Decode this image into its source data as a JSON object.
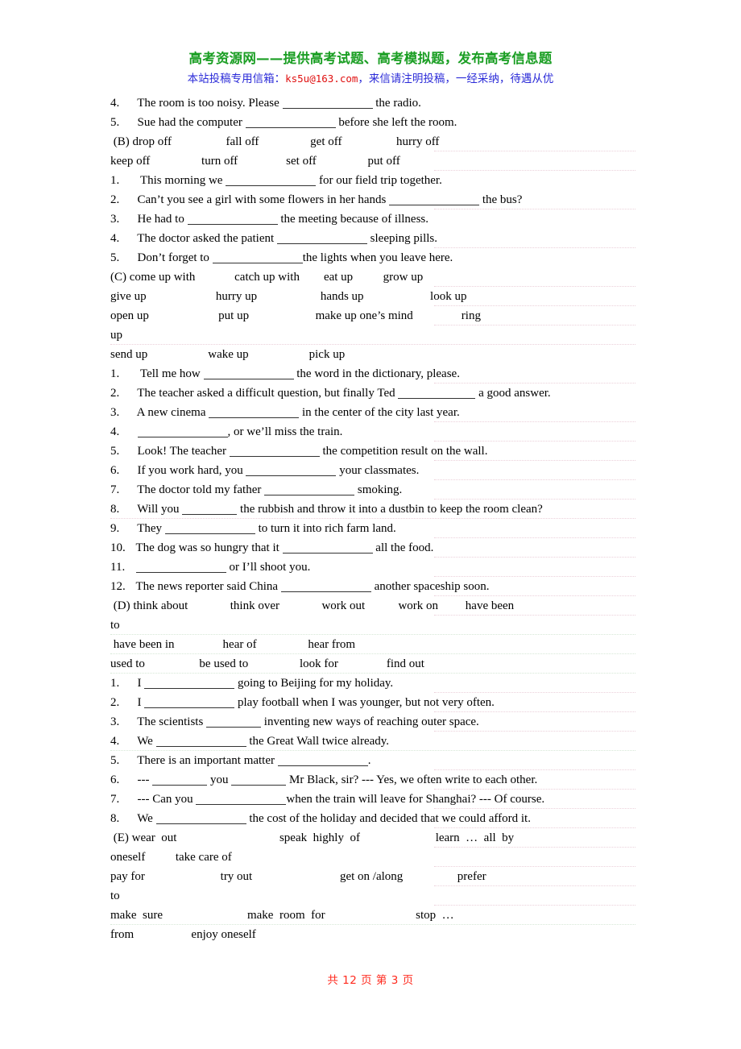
{
  "header": {
    "title_cn": "高考资源网——提供高考试题、高考模拟题，发布高考信息题",
    "sub_prefix": "本站投稿专用信箱：",
    "email": "ks5u@163.com",
    "sub_suffix": "，来信请注明投稿，一经采纳，待遇从优",
    "title_color": "#1a9e23",
    "sub_color": "#2b2bd8",
    "email_color": "#e01010"
  },
  "footer": {
    "text": "共 12 页   第 3 页",
    "color": "#ff2a1e"
  },
  "lines": [
    {
      "id": "a4",
      "num": "4.",
      "pre": "  The room is too noisy. Please ",
      "blank": "b-lg",
      "post": " the radio.",
      "rule": ""
    },
    {
      "id": "a5",
      "num": "5.",
      "pre": "  Sue had the computer ",
      "blank": "b-lg",
      "post": " before she left the room.",
      "rule": ""
    },
    {
      "id": "B-head",
      "text": " (B) drop off                  fall off                 get off                  hurry off",
      "rule": "rule rule-r"
    },
    {
      "id": "B-2",
      "text": "keep off                 turn off                set off                 put off",
      "rule": "rule rule-r"
    },
    {
      "id": "b1",
      "num": "1.",
      "pre": "   This morning we ",
      "blank": "b-lg",
      "post": " for our field trip together.",
      "rule": ""
    },
    {
      "id": "b2",
      "num": "2.",
      "pre": "  Can’t you see a girl with some flowers in her hands ",
      "blank": "b-lg",
      "post": " the bus?",
      "rule": "rule rule-r"
    },
    {
      "id": "b3",
      "num": "3.",
      "pre": "  He had to ",
      "blank": "b-lg",
      "post": " the meeting because of illness.",
      "rule": ""
    },
    {
      "id": "b4",
      "num": "4.",
      "pre": "  The doctor asked the patient ",
      "blank": "b-lg",
      "post": " sleeping pills.",
      "rule": "rule rule-r"
    },
    {
      "id": "b5",
      "num": "5.",
      "pre": "  Don’t forget to ",
      "blank": "b-lg",
      "post": "the lights when you leave here.",
      "rule": ""
    },
    {
      "id": "C-head",
      "text": "(C) come up with             catch up with        eat up          grow up",
      "rule": "rule rule-r"
    },
    {
      "id": "C-2",
      "text": "give up                       hurry up                     hands up                      look up",
      "rule": "rule rule-r"
    },
    {
      "id": "C-3",
      "text": "open up                       put up                      make up one’s mind                ring",
      "rule": "rule rule-r"
    },
    {
      "id": "C-4",
      "text": "up",
      "rule": "rule"
    },
    {
      "id": "C-5",
      "text": "send up                    wake up                    pick up",
      "rule": ""
    },
    {
      "id": "c1",
      "num": "1.",
      "pre": "   Tell me how ",
      "blank": "b-lg",
      "post": " the word in the dictionary, please.",
      "rule": "rule rule-r"
    },
    {
      "id": "c2",
      "num": "2.",
      "pre": "  The teacher asked a difficult question, but finally Ted ",
      "blank": "b-md",
      "post": " a good answer.",
      "rule": ""
    },
    {
      "id": "c3",
      "num": "3.",
      "pre": "  A new cinema ",
      "blank": "b-lg",
      "post": " in the center of the city last year.",
      "rule": "rule rule-r"
    },
    {
      "id": "c4",
      "num": "4.",
      "pre": "  ",
      "blank": "b-lg",
      "post": ", or we’ll miss the train.",
      "rule": "rule rule-r"
    },
    {
      "id": "c5",
      "num": "5.",
      "pre": "  Look! The teacher ",
      "blank": "b-lg",
      "post": " the competition result on the wall.",
      "rule": "rule rule-r"
    },
    {
      "id": "c6",
      "num": "6.",
      "pre": "  If you work hard, you ",
      "blank": "b-lg",
      "post": " your classmates.",
      "rule": "rule rule-r"
    },
    {
      "id": "c7",
      "num": "7.",
      "pre": "  The doctor told my father ",
      "blank": "b-lg",
      "post": " smoking.",
      "rule": "rule rule-r"
    },
    {
      "id": "c8",
      "num": "8.",
      "pre": "  Will you ",
      "blank": "b-sm",
      "post": " the rubbish and throw it into a dustbin to keep the room clean?",
      "rule": "rule"
    },
    {
      "id": "c9",
      "num": "9.",
      "pre": "  They ",
      "blank": "b-lg",
      "post": " to turn it into rich farm land.",
      "rule": "rule rule-r"
    },
    {
      "id": "c10",
      "num": "10.",
      "pre": " The dog was so hungry that it ",
      "blank": "b-lg",
      "post": " all the food.",
      "rule": "rule rule-r"
    },
    {
      "id": "c11",
      "num": "11.",
      "pre": " ",
      "blank": "b-lg",
      "post": " or I’ll shoot you.",
      "rule": "rule rule-r"
    },
    {
      "id": "c12",
      "num": "12.",
      "pre": " The news reporter said China ",
      "blank": "b-lg",
      "post": " another spaceship soon.",
      "rule": "rule rule-r"
    },
    {
      "id": "D-head",
      "text": " (D) think about              think over              work out           work on         have been",
      "rule": "rule rule-r"
    },
    {
      "id": "D-2",
      "text": "to",
      "rule": "rule rule-g"
    },
    {
      "id": "D-3",
      "text": " have been in                hear of                 hear from",
      "rule": "rule rule-g"
    },
    {
      "id": "D-4",
      "text": "used to                  be used to                 look for                find out",
      "rule": "rule rule-g"
    },
    {
      "id": "d1",
      "num": "1.",
      "pre": "  I ",
      "blank": "b-lg",
      "post": " going to Beijing for my holiday.",
      "rule": "rule rule-r"
    },
    {
      "id": "d2",
      "num": "2.",
      "pre": "  I ",
      "blank": "b-lg",
      "post": " play football when I was younger, but not very often.",
      "rule": "rule rule-r"
    },
    {
      "id": "d3",
      "num": "3.",
      "pre": "  The scientists ",
      "blank": "b-sm",
      "post": " inventing new ways of reaching outer space.",
      "rule": "rule rule-r"
    },
    {
      "id": "d4",
      "num": "4.",
      "pre": "  We ",
      "blank": "b-lg",
      "post": " the Great Wall twice already.",
      "rule": "rule rule-g"
    },
    {
      "id": "d5",
      "num": "5.",
      "pre": "  There is an important matter ",
      "blank": "b-lg",
      "post": ".",
      "rule": "rule rule-r"
    },
    {
      "id": "d6",
      "num": "6.",
      "pre": "  --- ",
      "blank": "b-sm",
      "post": " you ",
      "blank2": "b-sm",
      "post2": " Mr Black, sir? --- Yes, we often write to each other.",
      "rule": "rule rule-r"
    },
    {
      "id": "d7",
      "num": "7.",
      "pre": "  --- Can you ",
      "blank": "b-lg",
      "post": "when the train will leave for Shanghai? --- Of course.",
      "rule": "rule rule-r"
    },
    {
      "id": "d8",
      "num": "8.",
      "pre": "  We ",
      "blank": "b-lg",
      "post": " the cost of the holiday and decided that we could afford it.",
      "rule": "rule rule-r"
    },
    {
      "id": "E-head",
      "text": " (E) wear  out                                  speak  highly  of                         learn  …  all  by",
      "rule": "rule rule-r"
    },
    {
      "id": "E-2",
      "text": "oneself          take care of",
      "rule": "rule rule-r"
    },
    {
      "id": "E-3",
      "text": "pay for                         try out                             get on /along                  prefer",
      "rule": "rule rule-r"
    },
    {
      "id": "E-4",
      "text": "to",
      "rule": "rule rule-r"
    },
    {
      "id": "E-5",
      "text": "make  sure                            make  room  for                              stop  …",
      "rule": "rule rule-g"
    },
    {
      "id": "E-6",
      "text": "from                   enjoy oneself",
      "rule": ""
    }
  ]
}
